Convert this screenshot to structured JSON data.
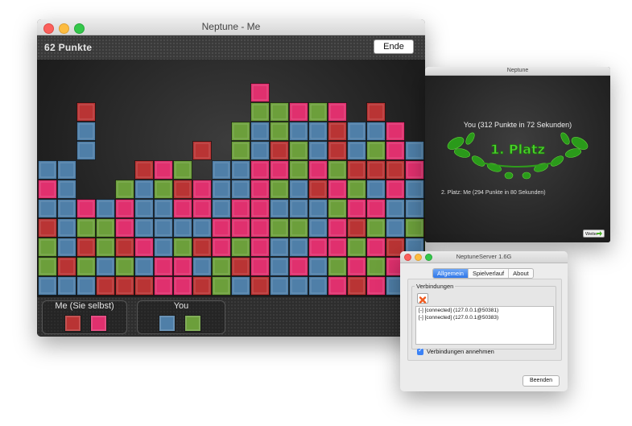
{
  "game_window": {
    "title": "Neptune - Me",
    "score": "62 Punkte",
    "end_button": "Ende",
    "colors": {
      "blue": "#4f7fa8",
      "red": "#b93434",
      "pink": "#e0306e",
      "green": "#6c9f3b",
      "board_bg": "#2a2a2a"
    },
    "board": [
      "...........p...........",
      "..r........ggpgp.r.....",
      "..b.......gbgbbrbbp....",
      "..b.....r.gbrgbrbgpb...",
      "bb...rpg.bbppgpgrrrpb..",
      "pb..gbgrpbbpgbrpgbpbbb.",
      "bbpbpbbppbppbbbgppbbgr.",
      "rbggpbbbbpppggbprgbgrb.",
      "gbrgrpbgrpgpbbppgprbgp.",
      "grgbgbppbgrpbpbgpgpbbp.",
      "bbbrrrpprgbrbbbprpbbbr."
    ],
    "players": [
      {
        "name": "Me (Sie selbst)",
        "swatches": [
          "#b93434",
          "#e0306e"
        ]
      },
      {
        "name": "You",
        "swatches": [
          "#4f7fa8",
          "#6c9f3b"
        ]
      }
    ]
  },
  "result_window": {
    "title": "Neptune",
    "winner": "You (312 Punkte in 72 Sekunden)",
    "place": "1. Platz",
    "second": "2. Platz: Me (294 Punkte in 80 Sekunden)",
    "next_button": "Weiter"
  },
  "server_window": {
    "title": "NeptuneServer 1.6G",
    "tabs": [
      "Allgemein",
      "Spielverlauf",
      "About"
    ],
    "active_tab": 0,
    "group_title": "Verbindungen",
    "connections": [
      "[-] [connected] (127.0.0.1@50381)",
      "[-] [connected] (127.0.0.1@50383)"
    ],
    "accept_label": "Verbindungen annehmen",
    "accept_checked": true,
    "quit_button": "Beenden"
  }
}
